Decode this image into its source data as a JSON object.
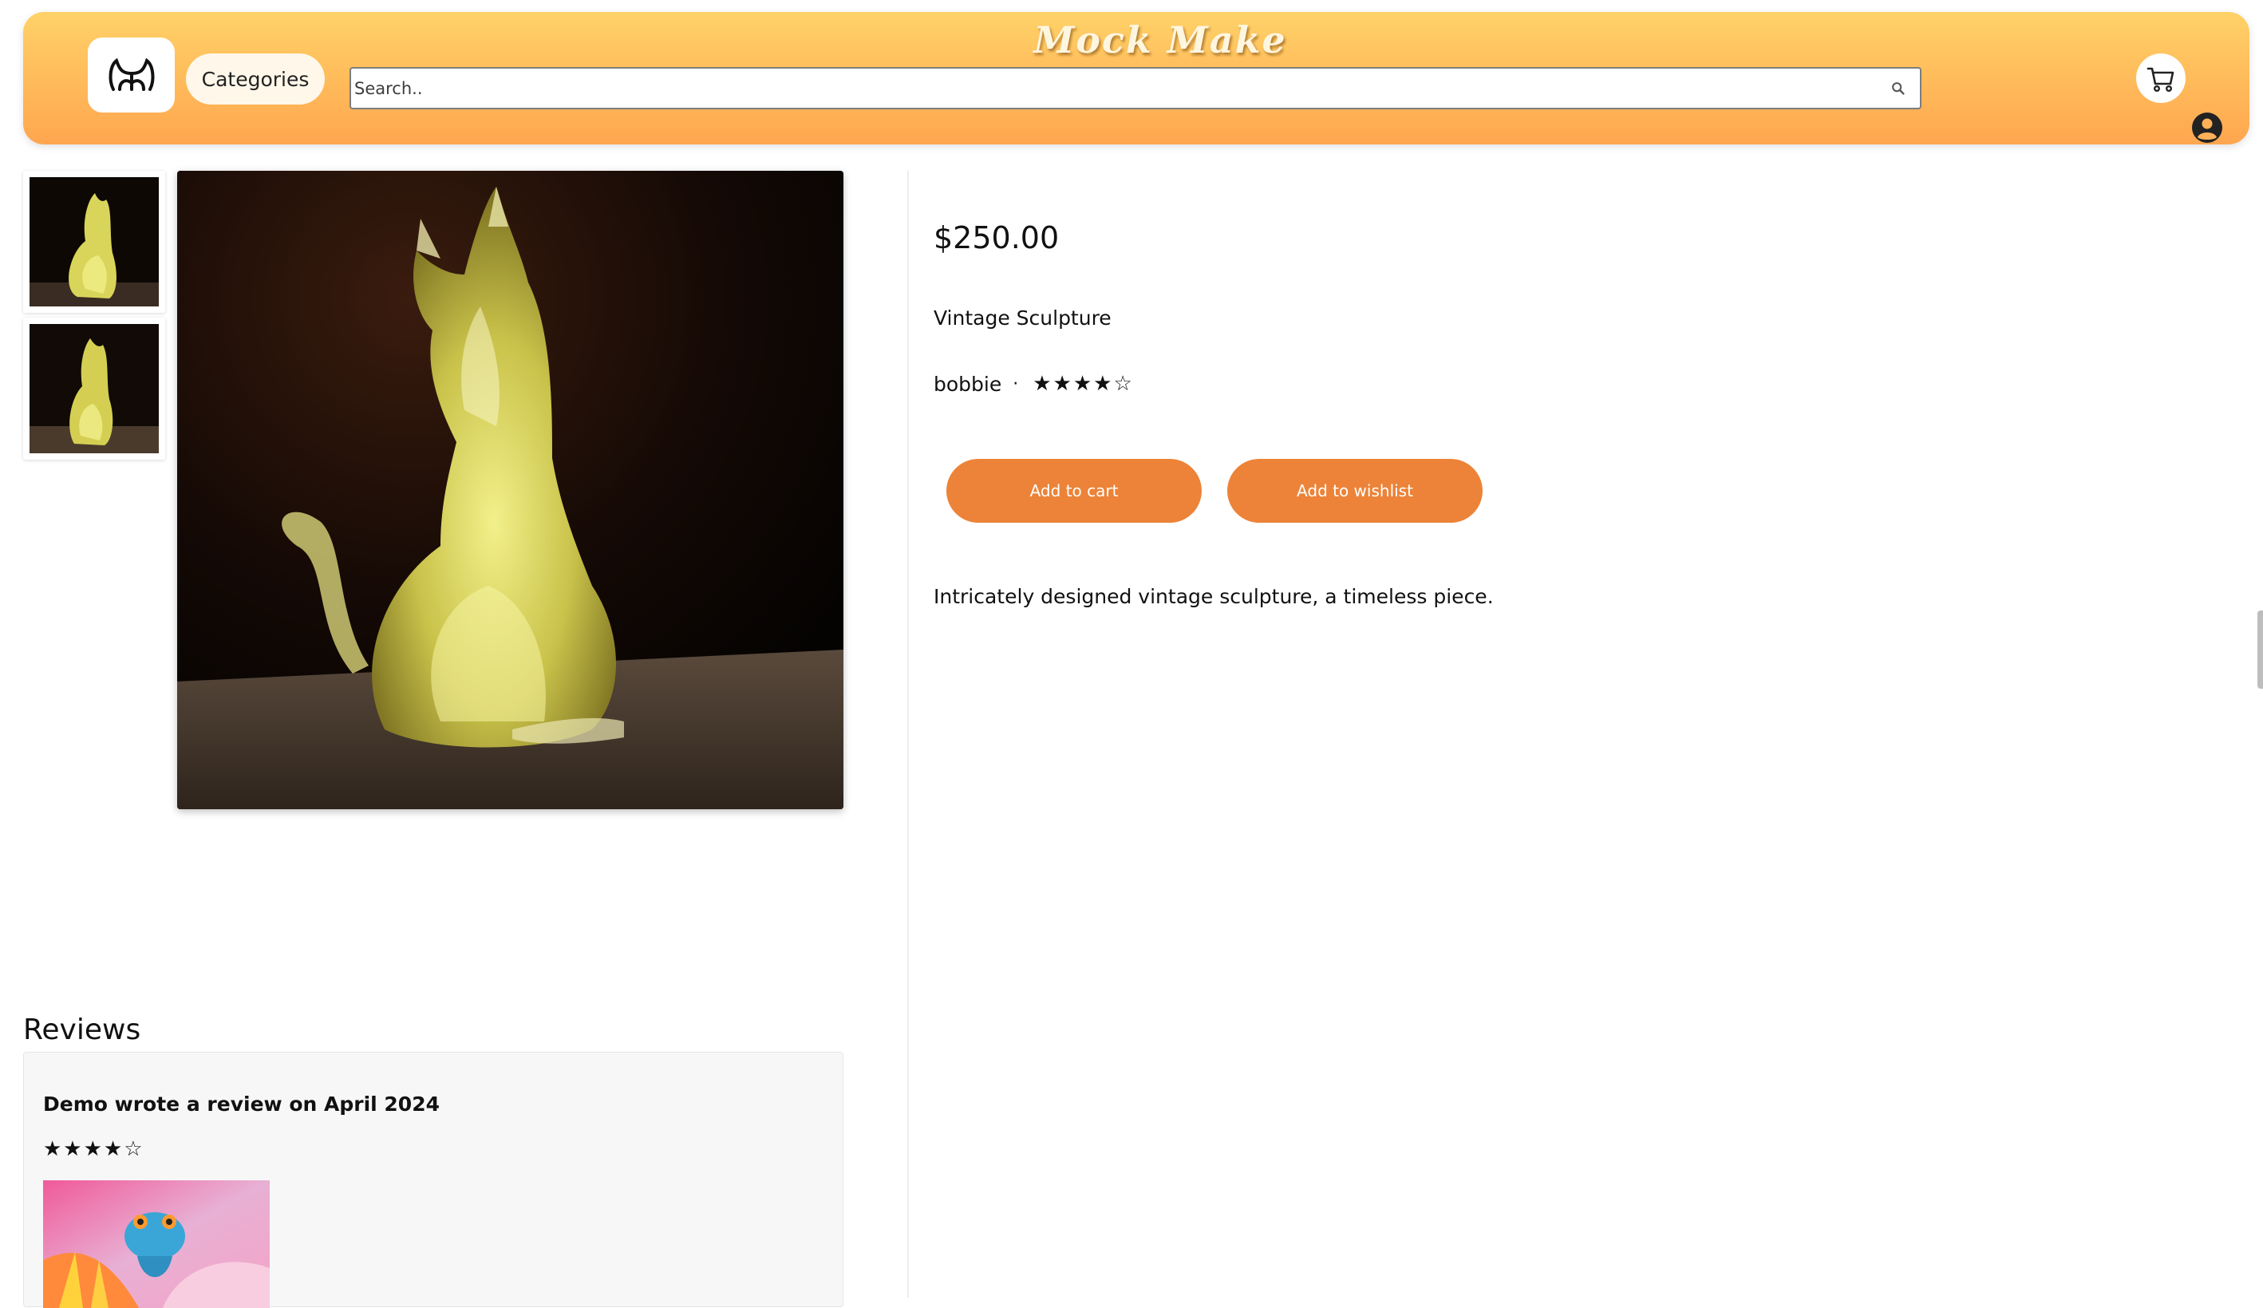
{
  "header": {
    "brand": "Mock Make",
    "categories_label": "Categories",
    "search_placeholder": "Search..",
    "icons": {
      "logo": "mock-make-logo-icon",
      "search": "search-icon",
      "cart": "cart-icon",
      "user": "user-account-icon"
    },
    "colors": {
      "gradient_top": "#ffd268",
      "gradient_bottom": "#ffa650"
    }
  },
  "product": {
    "price": "$250.00",
    "name": "Vintage Sculpture",
    "seller": "bobbie",
    "separator": "·",
    "rating_stars": "★★★★☆",
    "rating": 4,
    "rating_max": 5,
    "add_to_cart_label": "Add to cart",
    "add_to_wishlist_label": "Add to wishlist",
    "description": "Intricately designed vintage sculpture, a timeless piece.",
    "accent_color": "#ec8338"
  },
  "reviews": {
    "heading": "Reviews",
    "items": [
      {
        "title": "Demo wrote a review on April 2024",
        "rating_stars": "★★★★☆",
        "rating": 4
      }
    ]
  }
}
